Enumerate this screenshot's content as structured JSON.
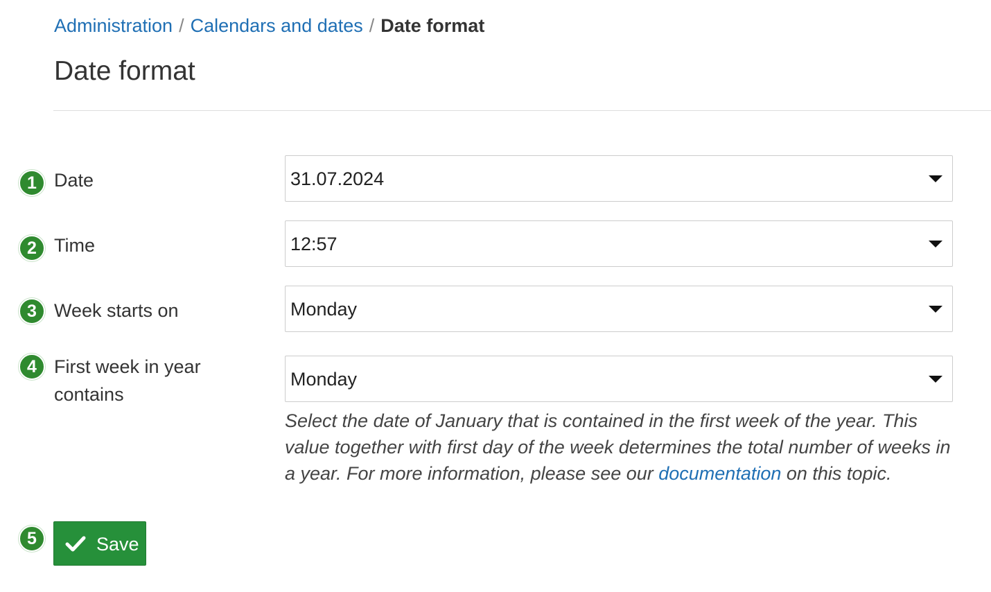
{
  "breadcrumb": {
    "items": [
      {
        "label": "Administration"
      },
      {
        "label": "Calendars and dates"
      }
    ],
    "separator": "/",
    "current": "Date format"
  },
  "page": {
    "title": "Date format"
  },
  "form": {
    "fields": [
      {
        "marker": "1",
        "label": "Date",
        "value": "31.07.2024"
      },
      {
        "marker": "2",
        "label": "Time",
        "value": "12:57"
      },
      {
        "marker": "3",
        "label": "Week starts on",
        "value": "Monday"
      },
      {
        "marker": "4",
        "label_line1": "First week in year",
        "label_line2": "contains",
        "value": "Monday"
      }
    ],
    "help": {
      "text_before_link": "Select the date of January that is contained in the first week of the year. This value together with first day of the week determines the total number of weeks in a year. For more information, please see our ",
      "link": "documentation",
      "text_after_link": " on this topic."
    }
  },
  "actions": {
    "save_marker": "5",
    "save_label": "Save",
    "save_icon": "checkmark-icon"
  },
  "colors": {
    "link": "#1f6fb4",
    "marker": "#2f8a2f",
    "save_button": "#26903a"
  }
}
